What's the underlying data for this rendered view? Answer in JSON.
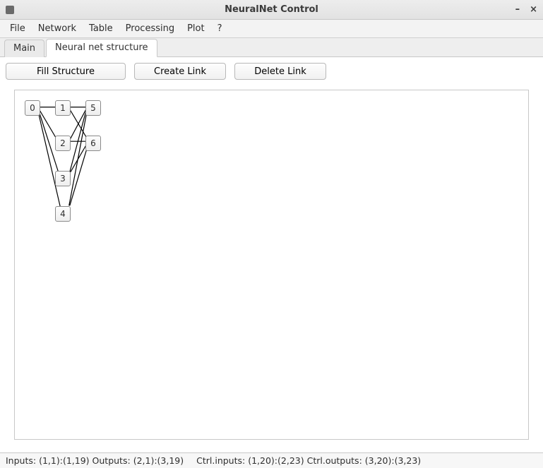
{
  "window": {
    "title": "NeuralNet Control"
  },
  "menu": {
    "file": "File",
    "network": "Network",
    "table": "Table",
    "processing": "Processing",
    "plot": "Plot",
    "help": "?"
  },
  "tabs": {
    "main": "Main",
    "structure": "Neural net structure"
  },
  "toolbar": {
    "fill": "Fill Structure",
    "create_link": "Create Link",
    "delete_link": "Delete Link"
  },
  "nodes": {
    "n0": "0",
    "n1": "1",
    "n2": "2",
    "n3": "3",
    "n4": "4",
    "n5": "5",
    "n6": "6"
  },
  "chart_data": {
    "type": "diagram",
    "description": "Neural network layer structure",
    "layers": [
      {
        "index": 0,
        "nodes": [
          0
        ]
      },
      {
        "index": 1,
        "nodes": [
          1,
          2,
          3,
          4
        ]
      },
      {
        "index": 2,
        "nodes": [
          5,
          6
        ]
      }
    ],
    "edges": [
      [
        0,
        1
      ],
      [
        0,
        2
      ],
      [
        0,
        3
      ],
      [
        0,
        4
      ],
      [
        1,
        5
      ],
      [
        1,
        6
      ],
      [
        2,
        5
      ],
      [
        2,
        6
      ],
      [
        3,
        5
      ],
      [
        3,
        6
      ],
      [
        4,
        5
      ],
      [
        4,
        6
      ]
    ]
  },
  "status": {
    "inputs_label": "Inputs:",
    "inputs_value": "(1,1):(1,19)",
    "outputs_label": "Outputs:",
    "outputs_value": "(2,1):(3,19)",
    "ctrl_inputs_label": "Ctrl.inputs:",
    "ctrl_inputs_value": "(1,20):(2,23)",
    "ctrl_outputs_label": "Ctrl.outputs:",
    "ctrl_outputs_value": "(3,20):(3,23)"
  }
}
